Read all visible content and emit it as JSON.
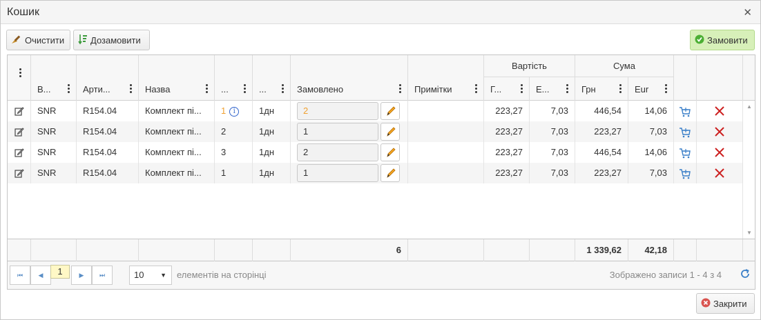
{
  "window": {
    "title": "Кошик"
  },
  "toolbar": {
    "clear_label": "Очистити",
    "reorder_label": "Дозамовити",
    "order_label": "Замовити"
  },
  "grid": {
    "columns": {
      "vendor": "В...",
      "article": "Арти...",
      "name": "Назва",
      "col_a": "...",
      "col_b": "...",
      "ordered": "Замовлено",
      "notes": "Примітки",
      "cost_group": "Вартість",
      "cost_uah": "Г...",
      "cost_eur": "Е...",
      "sum_group": "Сума",
      "sum_uah": "Грн",
      "sum_eur": "Eur"
    },
    "rows": [
      {
        "vendor": "SNR",
        "article": "R154.04",
        "name": "Комплект пі...",
        "col_a": "1",
        "col_b": "1дн",
        "ordered": "2",
        "notes": "",
        "cost_uah": "223,27",
        "cost_eur": "7,03",
        "sum_uah": "446,54",
        "sum_eur": "14,06"
      },
      {
        "vendor": "SNR",
        "article": "R154.04",
        "name": "Комплект пі...",
        "col_a": "2",
        "col_b": "1дн",
        "ordered": "1",
        "notes": "",
        "cost_uah": "223,27",
        "cost_eur": "7,03",
        "sum_uah": "223,27",
        "sum_eur": "7,03"
      },
      {
        "vendor": "SNR",
        "article": "R154.04",
        "name": "Комплект пі...",
        "col_a": "3",
        "col_b": "1дн",
        "ordered": "2",
        "notes": "",
        "cost_uah": "223,27",
        "cost_eur": "7,03",
        "sum_uah": "446,54",
        "sum_eur": "14,06"
      },
      {
        "vendor": "SNR",
        "article": "R154.04",
        "name": "Комплект пі...",
        "col_a": "1",
        "col_b": "1дн",
        "ordered": "1",
        "notes": "",
        "cost_uah": "223,27",
        "cost_eur": "7,03",
        "sum_uah": "223,27",
        "sum_eur": "7,03"
      }
    ],
    "totals": {
      "ordered": "6",
      "sum_uah": "1 339,62",
      "sum_eur": "42,18"
    }
  },
  "pager": {
    "current_page": "1",
    "page_size": "10",
    "page_size_label": "елементів на сторінці",
    "summary": "Зображено записи 1 - 4 з 4"
  },
  "footer_bar": {
    "close_label": "Закрити"
  },
  "colors": {
    "accent_orange": "#f0a030",
    "delete_red": "#cc2020",
    "cart_blue": "#3a7fc8",
    "order_green": "#d7f0b9"
  }
}
